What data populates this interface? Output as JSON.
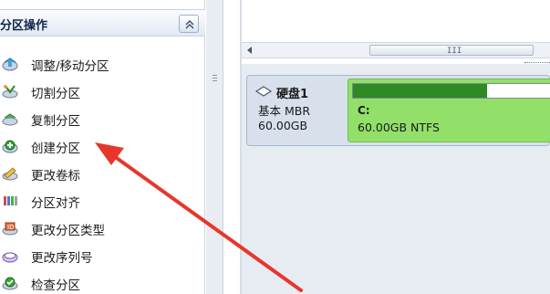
{
  "left_panel": {
    "title": "分区操作",
    "items": [
      {
        "label": "调整/移动分区",
        "icon": "resize-move-icon"
      },
      {
        "label": "切割分区",
        "icon": "split-icon"
      },
      {
        "label": "复制分区",
        "icon": "copy-icon"
      },
      {
        "label": "创建分区",
        "icon": "create-icon"
      },
      {
        "label": "更改卷标",
        "icon": "label-icon"
      },
      {
        "label": "分区对齐",
        "icon": "align-icon"
      },
      {
        "label": "更改分区类型",
        "icon": "change-type-icon"
      },
      {
        "label": "更改序列号",
        "icon": "serial-icon"
      },
      {
        "label": "检查分区",
        "icon": "check-icon"
      }
    ]
  },
  "disk": {
    "name": "硬盘1",
    "type": "基本 MBR",
    "size": "60.00GB",
    "partition": {
      "letter": "C:",
      "info": "60.00GB NTFS",
      "used_fraction": 0.66
    }
  },
  "colors": {
    "partition_fill": "#92e06a",
    "usage_fill": "#2d8a25",
    "annotation_arrow": "#e8362c"
  }
}
